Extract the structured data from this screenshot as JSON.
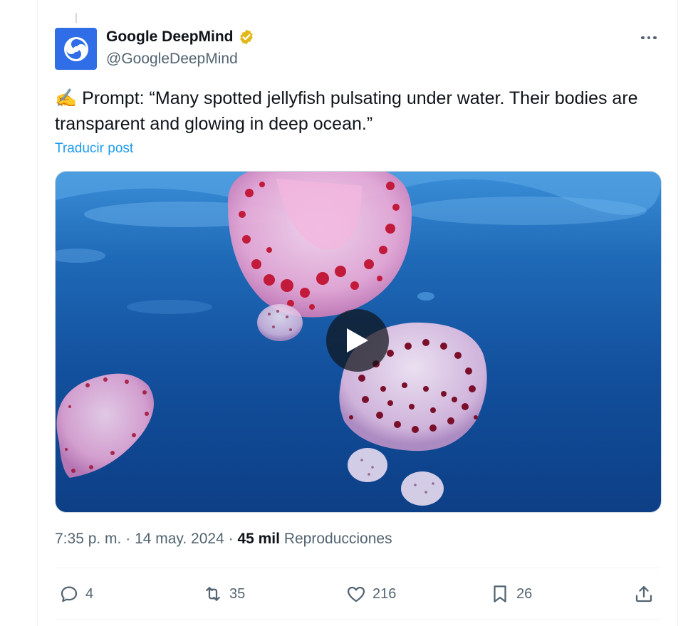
{
  "post": {
    "author": {
      "name": "Google DeepMind",
      "handle": "@GoogleDeepMind",
      "verified": true,
      "avatar_icon": "deepmind-logo",
      "avatar_color": "#2f6ee6"
    },
    "text": "✍️ Prompt: “Many spotted jellyfish pulsating under water. Their bodies are transparent and glowing in deep ocean.”",
    "translate_label": "Traducir post",
    "media": {
      "type": "video",
      "play_icon": "play-icon"
    },
    "meta": {
      "time": "7:35 p. m.",
      "separator1": " · ",
      "date": "14 may. 2024",
      "separator2": " · ",
      "views": "45 mil",
      "views_label": " Reproducciones"
    },
    "actions": {
      "replies": "4",
      "reposts": "35",
      "likes": "216",
      "bookmarks": "26"
    }
  },
  "colors": {
    "link": "#1d9bf0",
    "muted": "#536471",
    "verified_badge": "#e2b719"
  }
}
